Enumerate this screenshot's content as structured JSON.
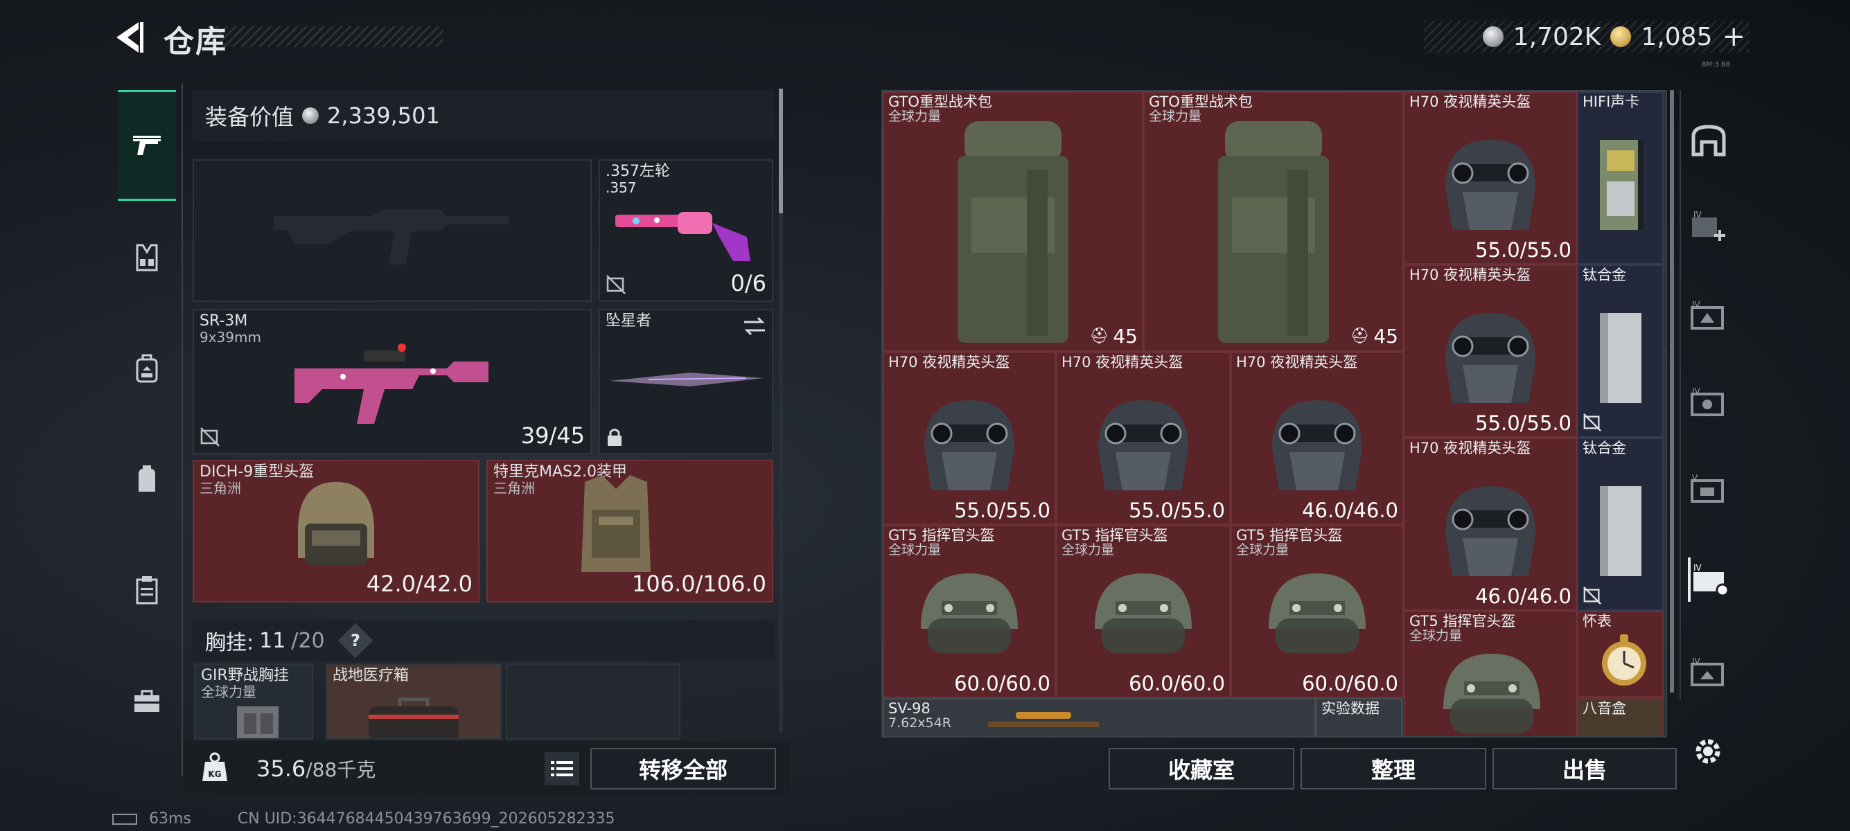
{
  "header": {
    "title": "仓库",
    "currencies": [
      {
        "icon": "silver-coin-icon",
        "value": "1,702K"
      },
      {
        "icon": "gold-coin-icon",
        "value": "1,085"
      }
    ],
    "add_label": "+",
    "version_text": "8M:3 B8"
  },
  "left_nav": [
    {
      "icon": "pistol-icon",
      "active": true
    },
    {
      "icon": "chest-rig-icon"
    },
    {
      "icon": "backpack-icon"
    },
    {
      "icon": "pouch-icon"
    },
    {
      "icon": "clipboard-icon"
    },
    {
      "icon": "toolbox-icon"
    }
  ],
  "equipment": {
    "value_label": "装备价值",
    "value": "2,339,501",
    "slots": {
      "primary_empty": {
        "label": ""
      },
      "revolver": {
        "name": ".357左轮",
        "sub": ".357",
        "ammo": "0/6"
      },
      "sr3m": {
        "name": "SR-3M",
        "sub": "9x39mm",
        "ammo": "39/45"
      },
      "melee": {
        "name": "坠星者"
      },
      "helmet": {
        "name": "DICH-9重型头盔",
        "sub": "三角洲",
        "durability": "42.0/42.0"
      },
      "armor": {
        "name": "特里克MAS2.0装甲",
        "sub": "三角洲",
        "durability": "106.0/106.0"
      }
    },
    "vest": {
      "label": "胸挂:",
      "used": "11",
      "total": "20",
      "help": "?"
    },
    "vest_items": [
      {
        "name": "GIR野战胸挂",
        "sub": "全球力量"
      },
      {
        "name": "战地医疗箱",
        "sub": ""
      },
      {
        "name": "",
        "sub": ""
      }
    ],
    "weight": {
      "current": "35.6",
      "max_unit": "/88千克"
    },
    "transfer_all": "转移全部"
  },
  "stash": {
    "items": {
      "gto1": {
        "name": "GTO重型战术包",
        "sub": "全球力量",
        "value": "45"
      },
      "gto2": {
        "name": "GTO重型战术包",
        "sub": "全球力量",
        "value": "45"
      },
      "h70a": {
        "name": "H70 夜视精英头盔",
        "value": "55.0/55.0"
      },
      "hifi": {
        "name": "HIFI声卡"
      },
      "h70b": {
        "name": "H70 夜视精英头盔",
        "value": "55.0/55.0"
      },
      "ti1": {
        "name": "钛合金"
      },
      "h70c": {
        "name": "H70 夜视精英头盔",
        "value": "55.0/55.0"
      },
      "h70d": {
        "name": "H70 夜视精英头盔",
        "value": "55.0/55.0"
      },
      "h70e": {
        "name": "H70 夜视精英头盔",
        "value": "46.0/46.0"
      },
      "h70f": {
        "name": "H70 夜视精英头盔",
        "value": "46.0/46.0"
      },
      "ti2": {
        "name": "钛合金"
      },
      "gt5a": {
        "name": "GT5 指挥官头盔",
        "sub": "全球力量",
        "value": "60.0/60.0"
      },
      "gt5b": {
        "name": "GT5 指挥官头盔",
        "sub": "全球力量",
        "value": "60.0/60.0"
      },
      "gt5c": {
        "name": "GT5 指挥官头盔",
        "sub": "全球力量",
        "value": "60.0/60.0"
      },
      "gt5d": {
        "name": "GT5 指挥官头盔",
        "sub": "全球力量"
      },
      "watch": {
        "name": "怀表"
      },
      "sv98": {
        "name": "SV-98",
        "sub": "7.62x54R"
      },
      "exp": {
        "name": "实验数据"
      },
      "bagua": {
        "name": "八音盒"
      }
    },
    "buttons": {
      "collection": "收藏室",
      "organize": "整理",
      "sell": "出售"
    }
  },
  "footer": {
    "ping": "63ms",
    "uid": "CN UID:3644768445043976369​9_202605282335"
  }
}
